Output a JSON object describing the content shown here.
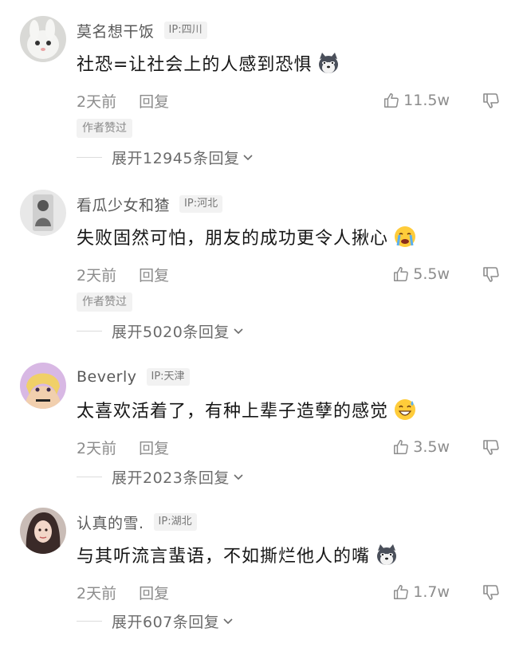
{
  "comments": [
    {
      "username": "莫名想干饭",
      "ip": "IP:四川",
      "text": "社恐=让社会上的人感到恐惧",
      "emoji": "husky-emoji",
      "time": "2天前",
      "reply": "回复",
      "likes": "11.5w",
      "author_badge": "作者赞过",
      "expand": "展开12945条回复"
    },
    {
      "username": "看瓜少女和猹",
      "ip": "IP:河北",
      "text": "失败固然可怕，朋友的成功更令人揪心",
      "emoji": "crying-face-emoji",
      "time": "2天前",
      "reply": "回复",
      "likes": "5.5w",
      "author_badge": "作者赞过",
      "expand": "展开5020条回复"
    },
    {
      "username": "Beverly",
      "ip": "IP:天津",
      "text": "太喜欢活着了，有种上辈子造孽的感觉",
      "emoji": "grinning-sweat-emoji",
      "time": "2天前",
      "reply": "回复",
      "likes": "3.5w",
      "author_badge": "",
      "expand": "展开2023条回复"
    },
    {
      "username": "认真的雪.",
      "ip": "IP:湖北",
      "text": "与其听流言蜚语，不如撕烂他人的嘴",
      "emoji": "husky-emoji",
      "time": "2天前",
      "reply": "回复",
      "likes": "1.7w",
      "author_badge": "",
      "expand": "展开607条回复"
    }
  ],
  "icons": {
    "like": "thumbs-up-icon",
    "dislike": "thumbs-down-icon",
    "expand": "chevron-down-icon"
  },
  "colors": {
    "text": "#161616",
    "muted": "#8c8c8c",
    "badge_bg": "#f2f2f2"
  }
}
